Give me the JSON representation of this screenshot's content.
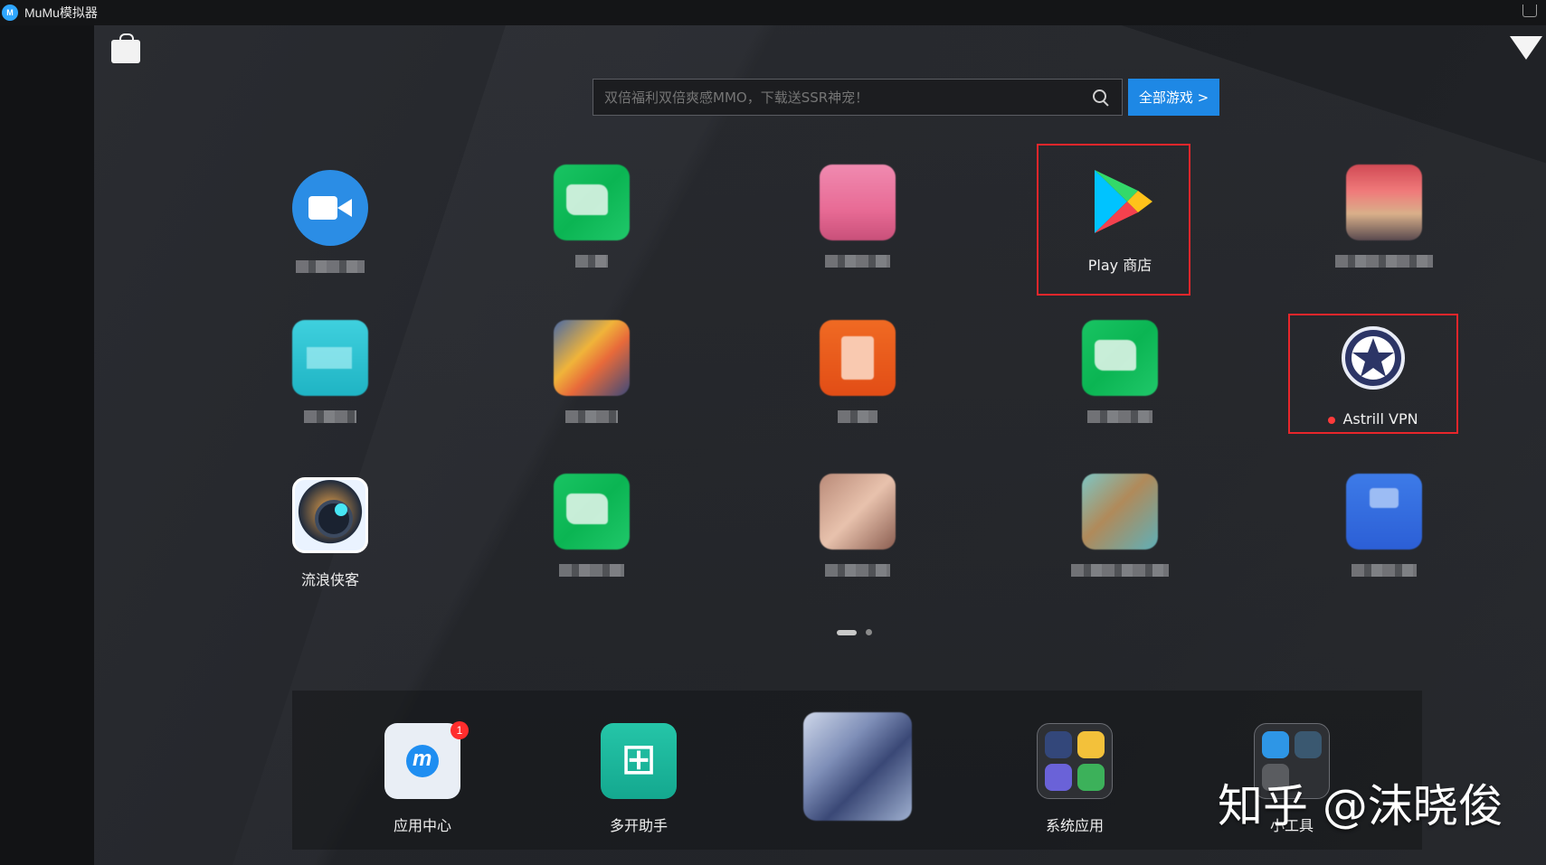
{
  "window": {
    "title": "MuMu模拟器",
    "logo_text": "M"
  },
  "search": {
    "placeholder": "双倍福利双倍爽感MMO，下载送SSR神宠！",
    "all_games_label": "全部游戏 >"
  },
  "apps": {
    "row1": [
      {
        "id": "video",
        "label_blurred": true
      },
      {
        "id": "green1",
        "label_blurred": true
      },
      {
        "id": "pink",
        "label_blurred": true
      },
      {
        "id": "play",
        "label": "Play 商店"
      },
      {
        "id": "anime",
        "label_blurred": true
      }
    ],
    "row2": [
      {
        "id": "teal",
        "label_blurred": true
      },
      {
        "id": "colorful",
        "label_blurred": true
      },
      {
        "id": "orange",
        "label_blurred": true
      },
      {
        "id": "green2",
        "label_blurred": true
      },
      {
        "id": "vpn",
        "label": "Astrill VPN"
      }
    ],
    "row3": [
      {
        "id": "liulang",
        "label": "流浪侠客"
      },
      {
        "id": "green3",
        "label_blurred": true
      },
      {
        "id": "face",
        "label_blurred": true
      },
      {
        "id": "map",
        "label_blurred": true
      },
      {
        "id": "blue",
        "label_blurred": true
      }
    ]
  },
  "dock": {
    "app_center": {
      "label": "应用中心",
      "badge": "1"
    },
    "multi": {
      "label": "多开助手"
    },
    "system": {
      "label": "系统应用"
    },
    "tools": {
      "label": "小工具"
    }
  },
  "pager": {
    "pages": 2,
    "active": 1
  },
  "watermark": "知乎 @沫晓俊",
  "colors": {
    "accent": "#1e88e5",
    "highlight_frame": "#e8262b",
    "background": "#1f2125"
  }
}
